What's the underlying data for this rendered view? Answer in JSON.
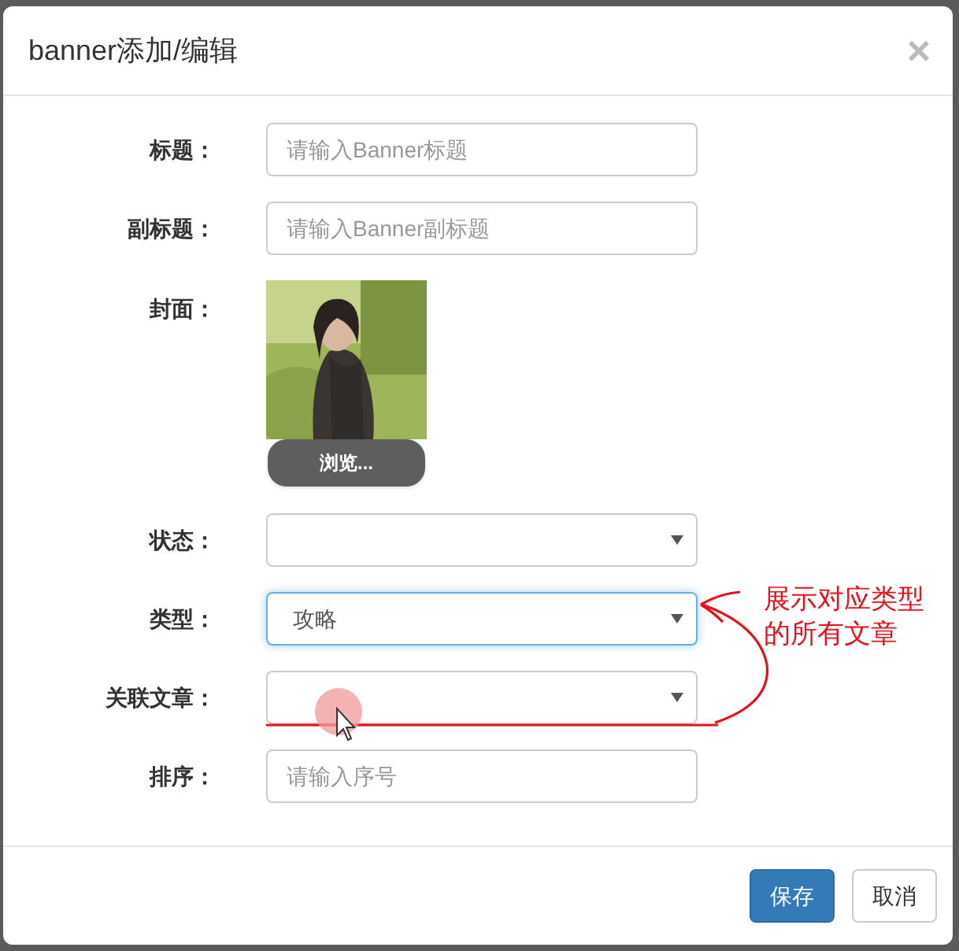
{
  "dialog": {
    "title": "banner添加/编辑",
    "close": "×"
  },
  "fields": [
    {
      "kind": "text",
      "label": "标题：",
      "placeholder": "请输入Banner标题"
    },
    {
      "kind": "text",
      "label": "副标题：",
      "placeholder": "请输入Banner副标题"
    },
    {
      "label": "封面：",
      "button": "浏览..."
    },
    {
      "kind": "select",
      "label": "状态：",
      "focused": false
    },
    {
      "kind": "select",
      "label": "类型：",
      "value": "攻略",
      "focused": true
    },
    {
      "kind": "select",
      "label": "关联文章：",
      "focused": false
    },
    {
      "kind": "text",
      "label": "排序：",
      "placeholder": "请输入序号"
    }
  ],
  "annotation": {
    "text": "展示对应类型的所有文章"
  },
  "buttons": [
    {
      "label": "保存",
      "kind": "primary"
    },
    {
      "label": "取消",
      "kind": "default"
    }
  ]
}
